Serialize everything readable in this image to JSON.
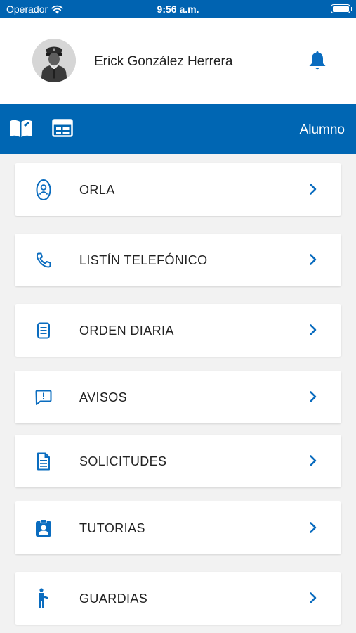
{
  "status_bar": {
    "carrier": "Operador",
    "time": "9:56 a.m."
  },
  "profile": {
    "name": "Erick González Herrera"
  },
  "tabbar": {
    "role": "Alumno"
  },
  "menu": [
    {
      "label": "ORLA",
      "icon": "person-badge-icon"
    },
    {
      "label": "LISTÍN TELEFÓNICO",
      "icon": "phone-icon"
    },
    {
      "label": "ORDEN DIARIA",
      "icon": "document-list-icon"
    },
    {
      "label": "AVISOS",
      "icon": "alert-message-icon"
    },
    {
      "label": "SOLICITUDES",
      "icon": "file-text-icon"
    },
    {
      "label": "TUTORIAS",
      "icon": "clipboard-user-icon"
    },
    {
      "label": "GUARDIAS",
      "icon": "standing-person-icon"
    }
  ],
  "colors": {
    "brand": "#0066b3",
    "accent": "#0a6cbf",
    "background": "#f2f2f2"
  }
}
